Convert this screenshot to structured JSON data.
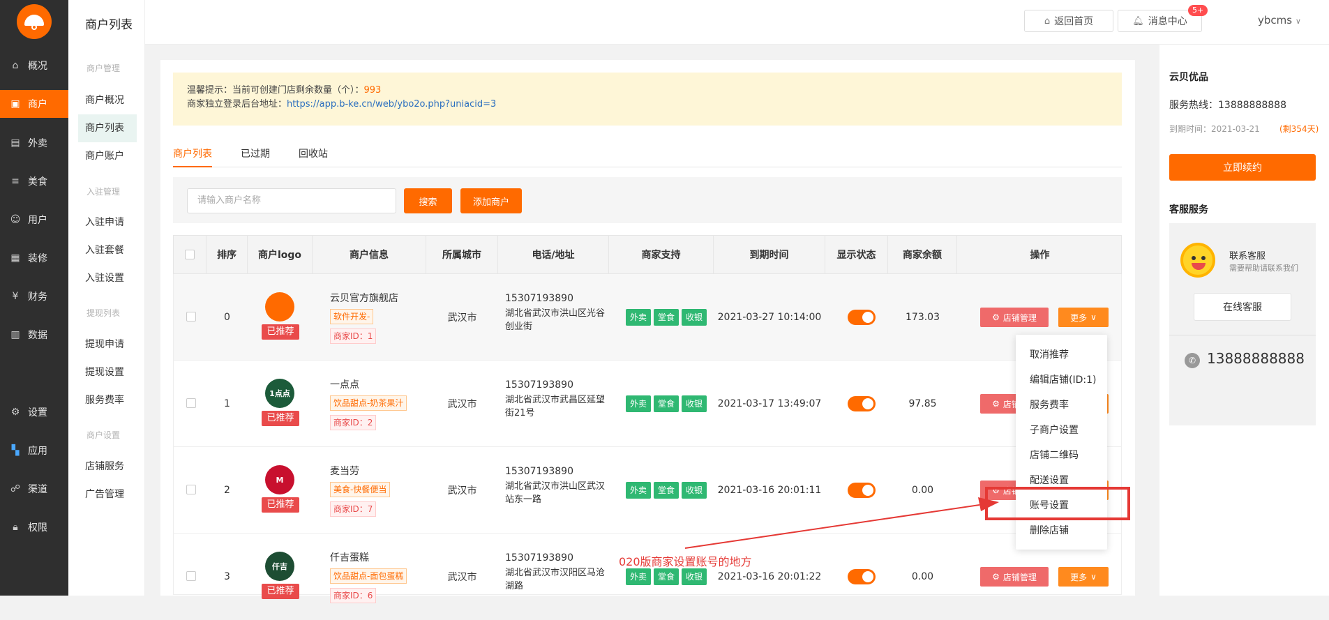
{
  "rail": [
    {
      "label": "概况",
      "icon": "home-icon"
    },
    {
      "label": "商户",
      "icon": "store-icon"
    },
    {
      "label": "外卖",
      "icon": "takeout-icon"
    },
    {
      "label": "美食",
      "icon": "menu-icon"
    },
    {
      "label": "用户",
      "icon": "user-icon"
    },
    {
      "label": "装修",
      "icon": "decorate-icon"
    },
    {
      "label": "财务",
      "icon": "finance-icon"
    },
    {
      "label": "数据",
      "icon": "chart-icon"
    },
    {
      "label": "设置",
      "icon": "gear-icon"
    },
    {
      "label": "应用",
      "icon": "apps-icon"
    },
    {
      "label": "渠道",
      "icon": "channel-icon"
    },
    {
      "label": "权限",
      "icon": "lock-icon"
    }
  ],
  "sub": {
    "groups": [
      "商户管理",
      "入驻管理",
      "提现列表",
      "商户设置"
    ],
    "items": [
      "商户概况",
      "商户列表",
      "商户账户",
      "入驻申请",
      "入驻套餐",
      "入驻设置",
      "提现申请",
      "提现设置",
      "服务费率",
      "店铺服务",
      "广告管理"
    ]
  },
  "header": {
    "title": "商户列表",
    "home_btn": "返回首页",
    "msg_btn": "消息中心",
    "msg_badge": "5+",
    "user": "ybcms"
  },
  "notice": {
    "line1_prefix": "温馨提示：当前可创建门店剩余数量（个）：",
    "count": "993",
    "line2_prefix": "商家独立登录后台地址：",
    "url": "https://app.b-ke.cn/web/ybo2o.php?uniacid=3"
  },
  "tabs": [
    "商户列表",
    "已过期",
    "回收站"
  ],
  "search": {
    "placeholder": "请输入商户名称",
    "search_btn": "搜索",
    "add_btn": "添加商户"
  },
  "table": {
    "headers": [
      "排序",
      "商户logo",
      "商户信息",
      "所属城市",
      "电话/地址",
      "商家支持",
      "到期时间",
      "显示状态",
      "商家余额",
      "操作"
    ],
    "rec_label": "已推荐",
    "support_tags": [
      "外卖",
      "堂食",
      "收银"
    ],
    "manage_btn": "店铺管理",
    "more_btn": "更多",
    "rows": [
      {
        "sort": "0",
        "name": "云贝官方旗舰店",
        "category": "软件开发-",
        "merchant_id": "商家ID：1",
        "city": "武汉市",
        "phone": "15307193890",
        "address": "湖北省武汉市洪山区光谷创业街",
        "expire": "2021-03-27 10:14:00",
        "balance": "173.03",
        "logo_color": "#ff6a00",
        "logo_text": ""
      },
      {
        "sort": "1",
        "name": "一点点",
        "category": "饮品甜点-奶茶果汁",
        "merchant_id": "商家ID：2",
        "city": "武汉市",
        "phone": "15307193890",
        "address": "湖北省武汉市武昌区延望街21号",
        "expire": "2021-03-17 13:49:07",
        "balance": "97.85",
        "logo_color": "#1c5b3a",
        "logo_text": "1点点"
      },
      {
        "sort": "2",
        "name": "麦当劳",
        "category": "美食-快餐便当",
        "merchant_id": "商家ID：7",
        "city": "武汉市",
        "phone": "15307193890",
        "address": "湖北省武汉市洪山区武汉站东一路",
        "expire": "2021-03-16 20:01:11",
        "balance": "0.00",
        "logo_color": "#c8102e",
        "logo_text": "M"
      },
      {
        "sort": "3",
        "name": "仟吉蛋糕",
        "category": "饮品甜点-面包蛋糕",
        "merchant_id": "商家ID：6",
        "city": "武汉市",
        "phone": "15307193890",
        "address": "湖北省武汉市汉阳区马沧湖路",
        "expire": "2021-03-16 20:01:22",
        "balance": "0.00",
        "logo_color": "#1d4d33",
        "logo_text": "仟吉"
      }
    ]
  },
  "dropdown": [
    "取消推荐",
    "编辑店铺(ID:1)",
    "服务费率",
    "子商户设置",
    "店铺二维码",
    "配送设置",
    "账号设置",
    "删除店铺"
  ],
  "annotation": "020版商家设置账号的地方",
  "right_panel": {
    "title": "云贝优品",
    "hotline": "服务热线：13888888888",
    "expire": "到期时间：2021-03-21",
    "days": "(剩354天)",
    "renew_btn": "立即续约",
    "cs_title": "客服服务",
    "cs_name": "联系客服",
    "cs_sub": "需要帮助请联系我们",
    "cs_btn": "在线客服",
    "phone": "13888888888"
  },
  "colors": {
    "accent": "#ff6a00",
    "danger": "#e94b4b",
    "success": "#2fb872",
    "rail": "#2f2f2f"
  }
}
